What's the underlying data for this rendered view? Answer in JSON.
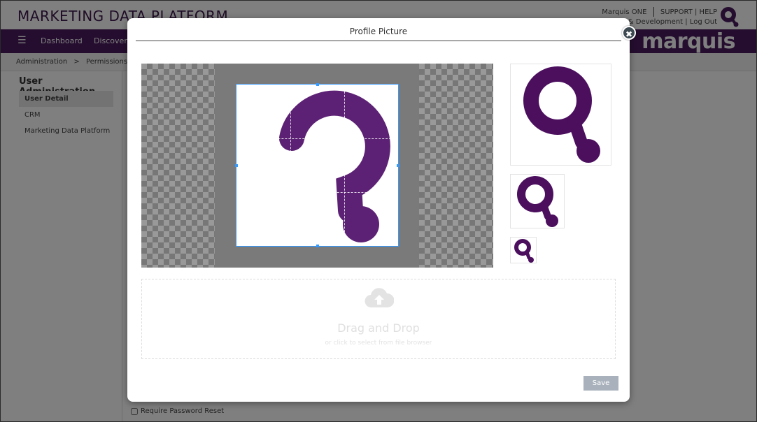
{
  "header": {
    "brand": "MARKETING DATA PLATFORM",
    "links": {
      "marquis_one": "Marquis ONE",
      "support": "SUPPORT",
      "help": "HELP",
      "development": "& Development",
      "logout": "Log Out",
      "pipe": "|"
    }
  },
  "navbar": {
    "menu_icon": "☰",
    "items": [
      "Dashboard",
      "Discovery"
    ],
    "logo": "marquis"
  },
  "breadcrumb": {
    "items": [
      "Administration",
      "Permissions"
    ],
    "separator": ">"
  },
  "sidebar": {
    "title": "User Administration",
    "items": [
      {
        "label": "User Detail",
        "active": true
      },
      {
        "label": "CRM",
        "active": false
      },
      {
        "label": "Marketing Data Platform",
        "active": false
      }
    ]
  },
  "form": {
    "require_password_reset": "Require Password Reset"
  },
  "modal": {
    "title": "Profile Picture",
    "close_glyph": "✖",
    "dropzone": {
      "title": "Drag and Drop",
      "subtitle": "or click to select from file browser"
    },
    "save_label": "Save"
  },
  "colors": {
    "brand_purple": "#4a1a5e",
    "logo_purple": "#5c2174",
    "preview_purple": "#4b0f5e",
    "crop_border": "#3399ff",
    "save_button": "#a9b2bc"
  },
  "icons": [
    "menu-icon",
    "q-logo-icon",
    "close-icon",
    "cloud-upload-icon"
  ]
}
